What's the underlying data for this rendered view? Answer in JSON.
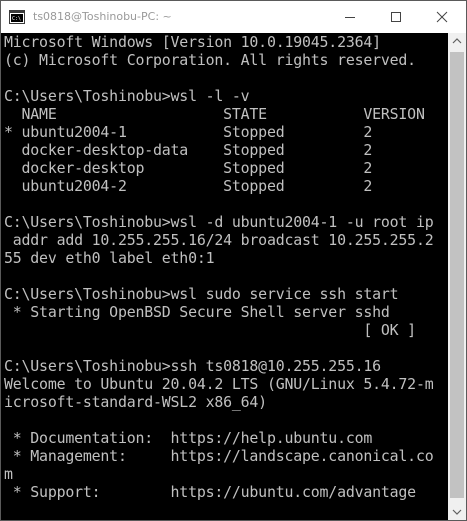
{
  "window": {
    "title": "ts0818@Toshinobu-PC: ~",
    "icon": "console-app-icon",
    "controls": {
      "minimize": "minimize-icon",
      "maximize": "maximize-icon",
      "close": "close-icon"
    }
  },
  "terminal": {
    "lines": [
      "Microsoft Windows [Version 10.0.19045.2364]",
      "(c) Microsoft Corporation. All rights reserved.",
      "",
      "C:\\Users\\Toshinobu>wsl -l -v",
      "  NAME                   STATE           VERSION",
      "* ubuntu2004-1           Stopped         2",
      "  docker-desktop-data    Stopped         2",
      "  docker-desktop         Stopped         2",
      "  ubuntu2004-2           Stopped         2",
      "",
      "C:\\Users\\Toshinobu>wsl -d ubuntu2004-1 -u root ip",
      " addr add 10.255.255.16/24 broadcast 10.255.255.2",
      "55 dev eth0 label eth0:1",
      "",
      "C:\\Users\\Toshinobu>wsl sudo service ssh start",
      " * Starting OpenBSD Secure Shell server sshd",
      "                                         [ OK ]",
      "",
      "C:\\Users\\Toshinobu>ssh ts0818@10.255.255.16",
      "Welcome to Ubuntu 20.04.2 LTS (GNU/Linux 5.4.72-m",
      "icrosoft-standard-WSL2 x86_64)",
      "",
      " * Documentation:  https://help.ubuntu.com",
      " * Management:     https://landscape.canonical.co",
      "m",
      " * Support:        https://ubuntu.com/advantage"
    ]
  },
  "colors": {
    "console_bg": "#000000",
    "console_fg": "#c0c0c0",
    "titlebar_bg": "#ffffff",
    "title_text": "#9a9a9a",
    "scrollbar_bg": "#f0f0f0",
    "scrollbar_thumb": "#c2c2c2"
  }
}
